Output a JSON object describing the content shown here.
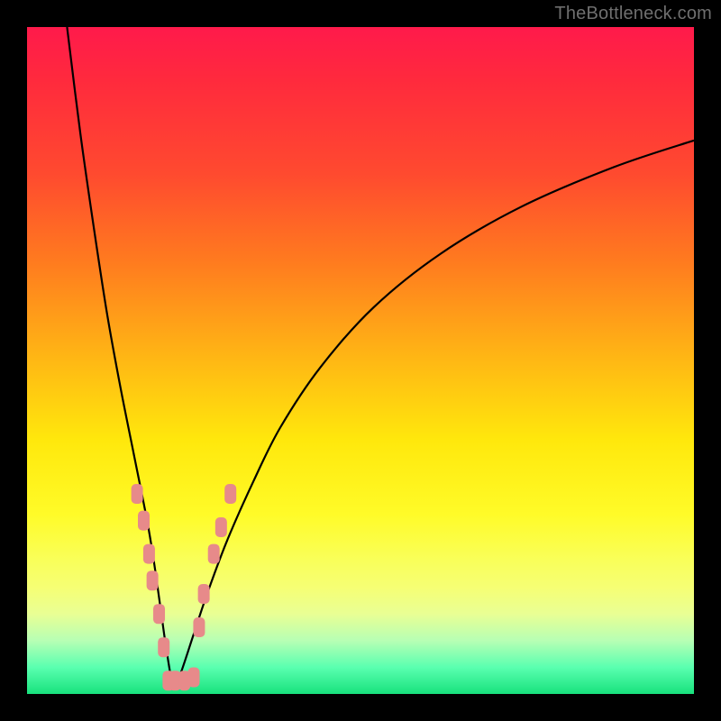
{
  "watermark": "TheBottleneck.com",
  "chart_data": {
    "type": "line",
    "title": "",
    "xlabel": "",
    "ylabel": "",
    "xlim": [
      0,
      100
    ],
    "ylim": [
      0,
      100
    ],
    "grid": false,
    "legend": false,
    "series": [
      {
        "name": "bottleneck-curve",
        "x": [
          6,
          8,
          10,
          12,
          14,
          16,
          18,
          19,
          20,
          21,
          22,
          23,
          25,
          27,
          30,
          34,
          38,
          44,
          52,
          62,
          74,
          88,
          100
        ],
        "y": [
          100,
          84,
          70,
          57,
          46,
          36,
          26,
          20,
          13,
          6,
          1,
          3,
          9,
          15,
          23,
          32,
          40,
          49,
          58,
          66,
          73,
          79,
          83
        ]
      }
    ],
    "markers": [
      {
        "name": "left-segment-1",
        "x": 16.5,
        "y": 30
      },
      {
        "name": "left-segment-2",
        "x": 17.5,
        "y": 26
      },
      {
        "name": "left-segment-3",
        "x": 18.3,
        "y": 21
      },
      {
        "name": "left-segment-4",
        "x": 18.8,
        "y": 17
      },
      {
        "name": "left-segment-5",
        "x": 19.8,
        "y": 12
      },
      {
        "name": "left-segment-6",
        "x": 20.5,
        "y": 7
      },
      {
        "name": "bottom-1",
        "x": 21.2,
        "y": 2
      },
      {
        "name": "bottom-2",
        "x": 22.2,
        "y": 2
      },
      {
        "name": "bottom-3",
        "x": 23.6,
        "y": 2
      },
      {
        "name": "bottom-4",
        "x": 25.0,
        "y": 2.5
      },
      {
        "name": "right-segment-1",
        "x": 25.8,
        "y": 10
      },
      {
        "name": "right-segment-2",
        "x": 26.5,
        "y": 15
      },
      {
        "name": "right-segment-3",
        "x": 28.0,
        "y": 21
      },
      {
        "name": "right-segment-4",
        "x": 29.1,
        "y": 25
      },
      {
        "name": "right-segment-5",
        "x": 30.5,
        "y": 30
      }
    ],
    "background_gradient": {
      "top": "#ff1a4b",
      "mid": "#ffe80c",
      "bottom": "#18e27d"
    }
  }
}
